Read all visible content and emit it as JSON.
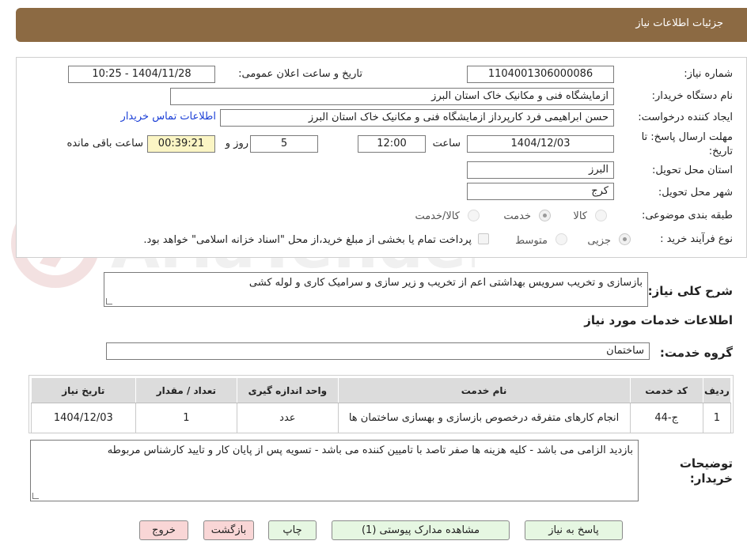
{
  "header": {
    "title": "جزئیات اطلاعات نیاز"
  },
  "form": {
    "need_number_label": "شماره نیاز:",
    "need_number": "1104001306000086",
    "announce_label": "تاریخ و ساعت اعلان عمومی:",
    "announce_value": "1404/11/28 - 10:25",
    "buyer_org_label": "نام دستگاه خریدار:",
    "buyer_org": "ازمایشگاه فنی و مکانیک خاک استان البرز",
    "requester_label": "ایجاد کننده درخواست:",
    "requester": "حسن ابراهیمی فرد کارپرداز ازمایشگاه فنی و مکانیک خاک استان البرز",
    "contact_link": "اطلاعات تماس خریدار",
    "deadline_label_1": "مهلت ارسال پاسخ: تا",
    "deadline_label_2": "تاریخ:",
    "deadline_date": "1404/12/03",
    "time_label": "ساعت",
    "deadline_time": "12:00",
    "days_value": "5",
    "days_label": "روز و",
    "remaining_time": "00:39:21",
    "remaining_label": "ساعت باقی مانده",
    "province_label": "استان محل تحویل:",
    "province": "البرز",
    "city_label": "شهر محل تحویل:",
    "city": "کرج",
    "category_label": "طبقه بندی موضوعی:",
    "category_options": [
      "کالا",
      "خدمت",
      "کالا/خدمت"
    ],
    "category_selected": "خدمت",
    "process_label": "نوع فرآیند خرید :",
    "process_options": [
      "جزیی",
      "متوسط"
    ],
    "process_selected": "جزیی",
    "payment_note": "پرداخت تمام یا بخشی از مبلغ خرید،از محل \"اسناد خزانه اسلامی\" خواهد بود."
  },
  "summary": {
    "label": "شرح کلی نیاز:",
    "value": "بازسازی و تخریب سرویس بهداشتی اعم از تخریب و زیر سازی و سرامیک کاری و لوله کشی"
  },
  "services": {
    "section_title": "اطلاعات خدمات مورد نیاز",
    "group_label": "گروه خدمت:",
    "group_value": "ساختمان",
    "columns": [
      "ردیف",
      "کد خدمت",
      "نام خدمت",
      "واحد اندازه گیری",
      "تعداد / مقدار",
      "تاریخ نیاز"
    ],
    "rows": [
      [
        "1",
        "ج-44",
        "انجام کارهای متفرقه درخصوص بازسازی و بهسازی ساختمان ها",
        "عدد",
        "1",
        "1404/12/03"
      ]
    ]
  },
  "buyer_notes": {
    "label_1": "توضیحات",
    "label_2": "خریدار:",
    "value": "بازدید الزامی می باشد - کلیه هزینه ها صفر تاصد با تامیین کننده می باشد  - تسویه پس از پایان کار و تایید کارشناس مربوطه"
  },
  "buttons": {
    "reply": "پاسخ به نیاز",
    "attachments": "مشاهده مدارک پیوستی (1)",
    "print": "چاپ",
    "back": "بازگشت",
    "exit": "خروج"
  },
  "colors": {
    "header": "#8c6a43",
    "remaining_bg": "#fbf5c4",
    "link": "#1a3ed6",
    "green_button": "#e6f7e2",
    "pink_button": "#f9d6d6"
  }
}
